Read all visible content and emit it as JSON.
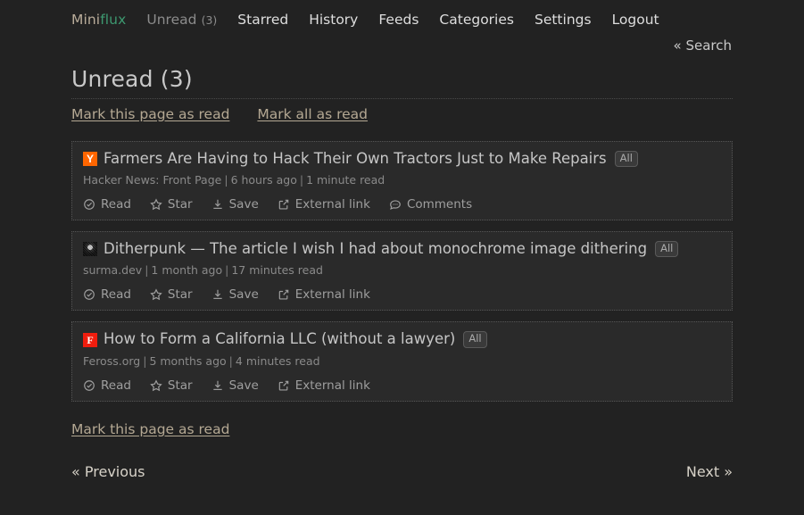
{
  "header": {
    "logo": {
      "part1": "Mini",
      "part2": "flux",
      "color1": "#b9ac9a",
      "color2": "#3d9970"
    },
    "nav": [
      {
        "label": "Unread",
        "count": "(3)",
        "active": true
      },
      {
        "label": "Starred"
      },
      {
        "label": "History"
      },
      {
        "label": "Feeds"
      },
      {
        "label": "Categories"
      },
      {
        "label": "Settings"
      },
      {
        "label": "Logout"
      }
    ],
    "search": "« Search"
  },
  "main": {
    "page_title": "Unread (3)",
    "bulk_actions": [
      {
        "label": "Mark this page as read"
      },
      {
        "label": "Mark all as read"
      }
    ],
    "footer_bulk_action": "Mark this page as read",
    "entries": [
      {
        "favicon": {
          "kind": "hn",
          "glyph": "Y",
          "bg": "#ff6600"
        },
        "title": "Farmers Are Having to Hack Their Own Tractors Just to Make Repairs",
        "badge": "All",
        "site": "Hacker News: Front Page",
        "age": "6 hours ago",
        "reading_time": "1 minute read",
        "actions": [
          {
            "icon": "check-circle-icon",
            "label": "Read"
          },
          {
            "icon": "star-icon",
            "label": "Star"
          },
          {
            "icon": "download-icon",
            "label": "Save"
          },
          {
            "icon": "external-link-icon",
            "label": "External link"
          },
          {
            "icon": "comments-icon",
            "label": "Comments"
          }
        ]
      },
      {
        "favicon": {
          "kind": "dither",
          "glyph": "",
          "bg": "#3a3a3a"
        },
        "title": "Ditherpunk — The article I wish I had about monochrome image dithering",
        "badge": "All",
        "site": "surma.dev",
        "age": "1 month ago",
        "reading_time": "17 minutes read",
        "actions": [
          {
            "icon": "check-circle-icon",
            "label": "Read"
          },
          {
            "icon": "star-icon",
            "label": "Star"
          },
          {
            "icon": "download-icon",
            "label": "Save"
          },
          {
            "icon": "external-link-icon",
            "label": "External link"
          }
        ]
      },
      {
        "favicon": {
          "kind": "feross",
          "glyph": "F",
          "bg": "#f01d0e"
        },
        "title": "How to Form a California LLC (without a lawyer)",
        "badge": "All",
        "site": "Feross.org",
        "age": "5 months ago",
        "reading_time": "4 minutes read",
        "actions": [
          {
            "icon": "check-circle-icon",
            "label": "Read"
          },
          {
            "icon": "star-icon",
            "label": "Star"
          },
          {
            "icon": "download-icon",
            "label": "Save"
          },
          {
            "icon": "external-link-icon",
            "label": "External link"
          }
        ]
      }
    ],
    "pagination": {
      "previous": "« Previous",
      "next": "Next »"
    }
  }
}
